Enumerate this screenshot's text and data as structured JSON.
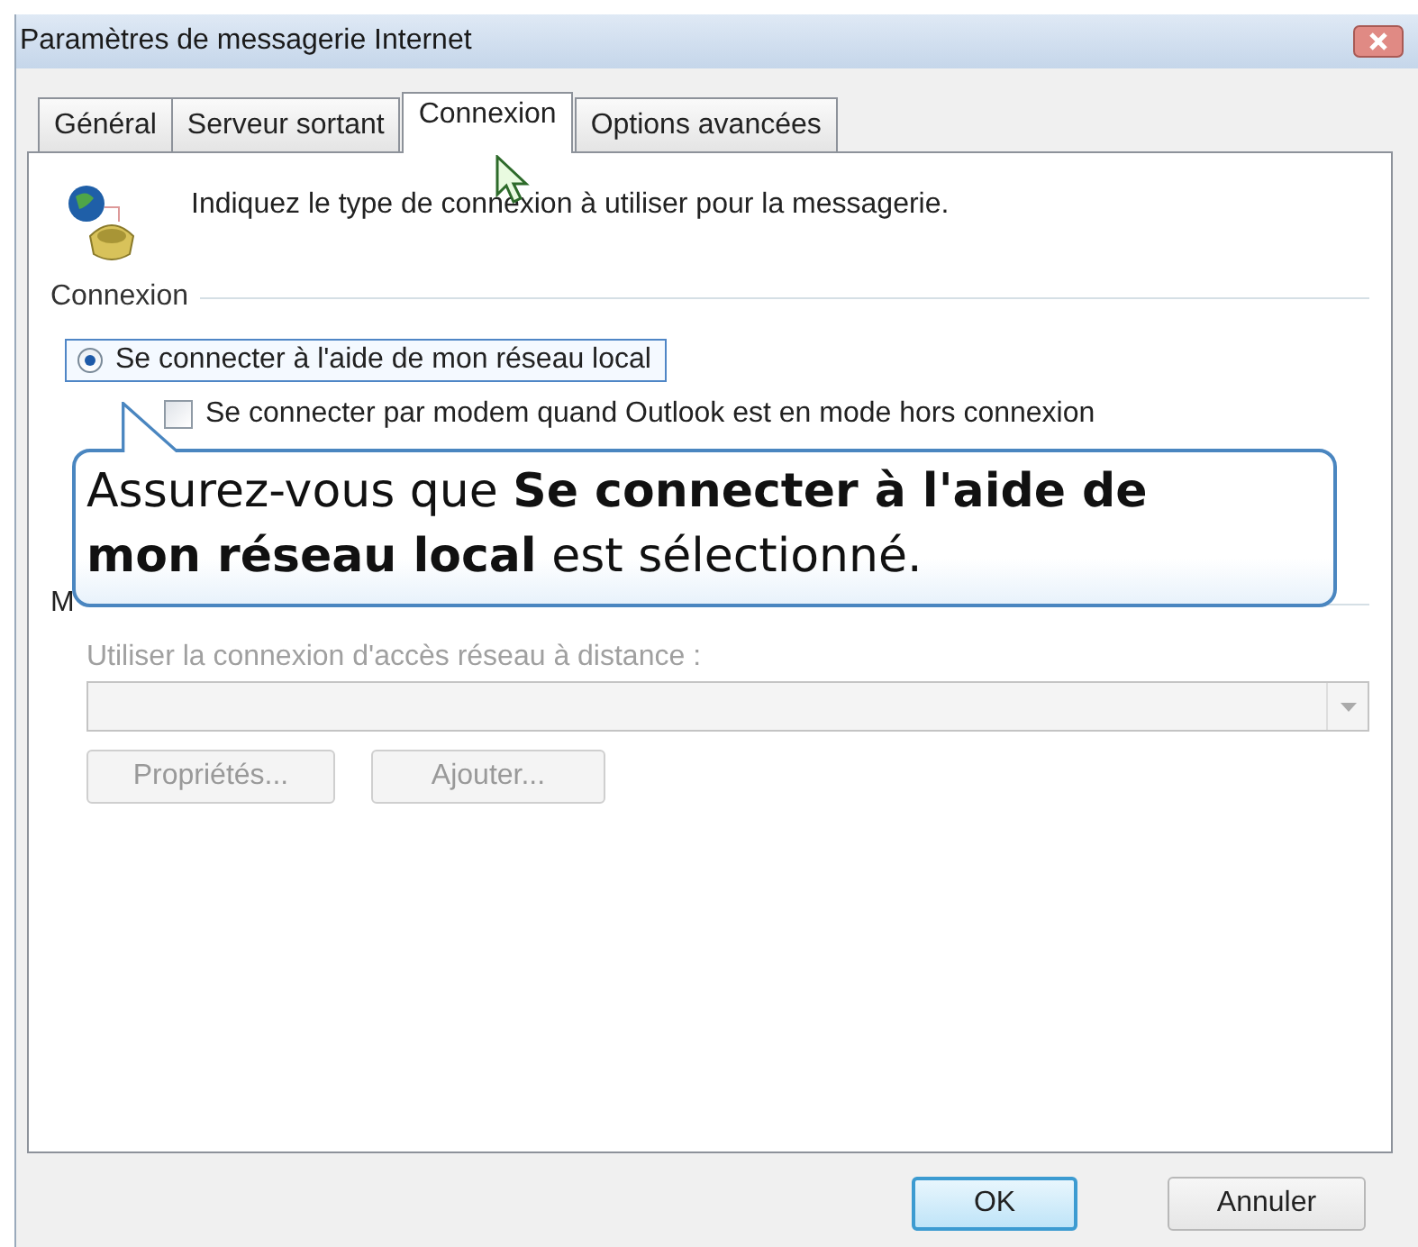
{
  "window": {
    "title": "Paramètres de messagerie Internet"
  },
  "tabs": [
    {
      "label": "Général",
      "selected": false
    },
    {
      "label": "Serveur sortant",
      "selected": false
    },
    {
      "label": "Connexion",
      "selected": true
    },
    {
      "label": "Options avancées",
      "selected": false
    }
  ],
  "intro": "Indiquez le type de connexion à utiliser pour la messagerie.",
  "connection_group": {
    "label": "Connexion",
    "options": [
      {
        "kind": "radio",
        "label": "Se connecter à l'aide de mon réseau local",
        "selected": true,
        "focused": true
      },
      {
        "kind": "checkbox",
        "label": "Se connecter par modem quand Outlook est en mode hors connexion",
        "checked": false,
        "focused": false
      }
    ]
  },
  "callout": {
    "text": "Assurez-vous que **Se connecter à l'aide de mon réseau local** est sélectionné."
  },
  "modem_group": {
    "label": "M",
    "dialup_label": "Utiliser la connexion d'accès réseau à distance :",
    "disabled": true,
    "buttons": [
      {
        "label": "Propriétés...",
        "disabled": true
      },
      {
        "label": "Ajouter...",
        "disabled": true
      }
    ]
  },
  "buttons": [
    {
      "label": "OK",
      "default": true
    },
    {
      "label": "Annuler",
      "default": false
    }
  ]
}
